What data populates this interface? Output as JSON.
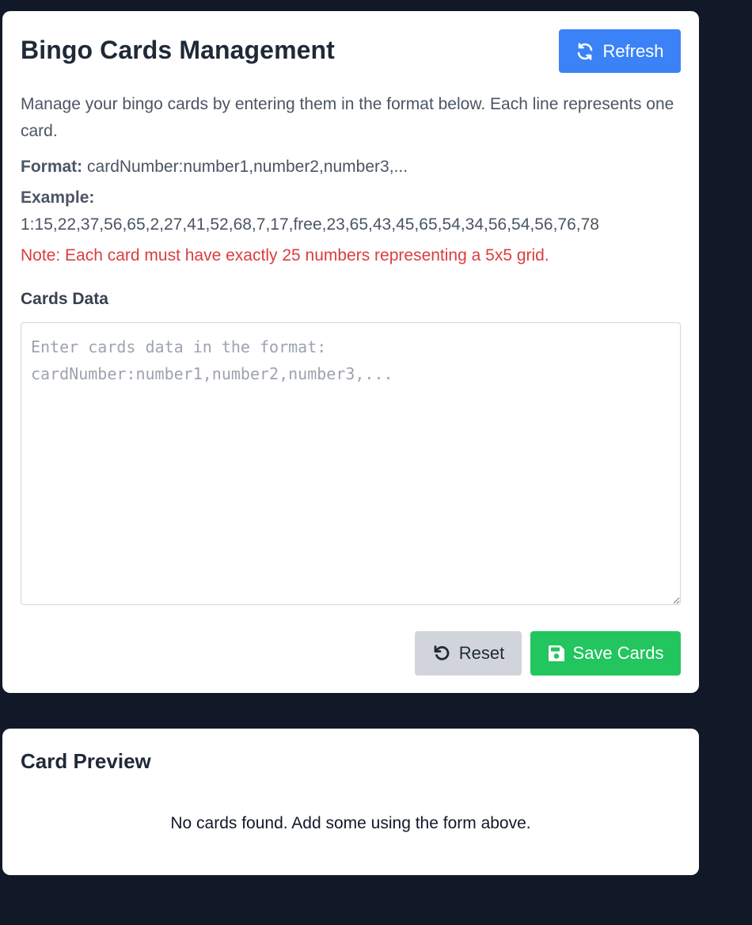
{
  "manage": {
    "title": "Bingo Cards Management",
    "refresh_label": "Refresh",
    "description": "Manage your bingo cards by entering them in the format below. Each line represents one card.",
    "format_label": "Format:",
    "format_value": "cardNumber:number1,number2,number3,...",
    "example_label": "Example:",
    "example_value": "1:15,22,37,56,65,2,27,41,52,68,7,17,free,23,65,43,45,65,54,34,56,54,56,76,78",
    "note": "Note: Each card must have exactly 25 numbers representing a 5x5 grid.",
    "cards_label": "Cards Data",
    "cards_value": "",
    "cards_placeholder": "Enter cards data in the format: cardNumber:number1,number2,number3,...",
    "reset_label": "Reset",
    "save_label": "Save Cards"
  },
  "preview": {
    "title": "Card Preview",
    "empty_message": "No cards found. Add some using the form above."
  },
  "icons": {
    "refresh": "refresh-icon",
    "reset": "undo-icon",
    "save": "floppy-disk-icon"
  },
  "colors": {
    "background": "#111827",
    "primary": "#3b82f6",
    "success": "#22c55e",
    "secondary": "#d1d5db",
    "danger": "#dc3d3d"
  }
}
